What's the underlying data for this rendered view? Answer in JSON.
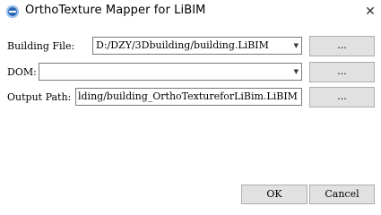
{
  "window": {
    "title": "OrthoTexture Mapper for LiBIM",
    "app_icon": "libim-app-icon",
    "close_glyph": "✕"
  },
  "form": {
    "building_file": {
      "label": "Building File:",
      "value": "D:/DZY/3Dbuilding/building.LiBIM",
      "browse_label": "..."
    },
    "dom": {
      "label": "DOM:",
      "value": "",
      "browse_label": "..."
    },
    "output_path": {
      "label": "Output Path:",
      "value": "lding/building_OrthoTextureforLiBim.LiBIM",
      "browse_label": "..."
    },
    "dropdown_arrow": "▼"
  },
  "buttons": {
    "ok_label": "OK",
    "cancel_label": "Cancel"
  }
}
